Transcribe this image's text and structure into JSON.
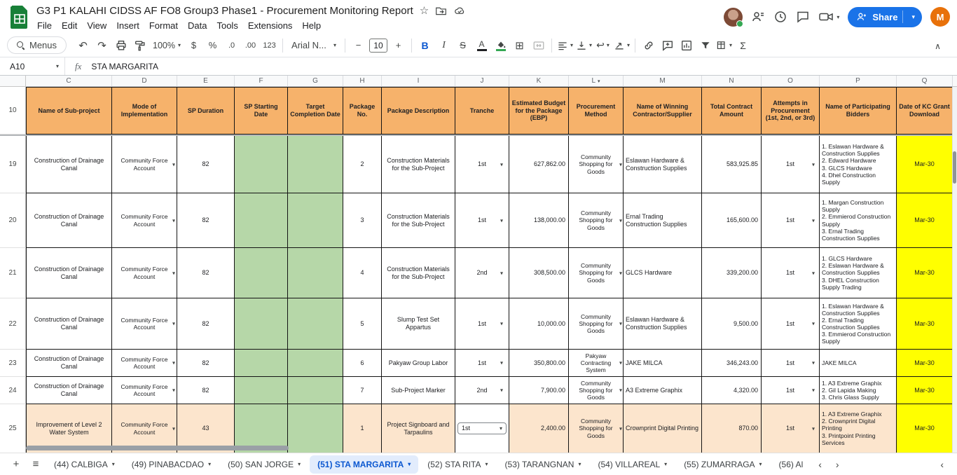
{
  "colors": {
    "accent_blue": "#1a73e8",
    "header_bg": "#f6b26b",
    "date_bg": "#b6d7a8",
    "kc_bg": "#ffff00",
    "active_row_bg": "#fce5cd",
    "active_tab_bg": "#e2ecfc",
    "active_tab_text": "#0b57d0",
    "avatar_bg": "#e8710a",
    "logo_green": "#188038"
  },
  "topbar": {
    "title": "G3 P1 KALAHI CIDSS AF  FO8 Group3 Phase1 - Procurement Monitoring Report",
    "share_label": "Share",
    "avatar_letter": "M"
  },
  "menu_items": [
    "File",
    "Edit",
    "View",
    "Insert",
    "Format",
    "Data",
    "Tools",
    "Extensions",
    "Help"
  ],
  "toolbar": {
    "menus_label": "Menus",
    "zoom": "100%",
    "font": "Arial N...",
    "font_size": "10"
  },
  "icons": {
    "undo": "↶",
    "redo": "↷",
    "star": "☆",
    "caret": "▾",
    "dollar": "$",
    "percent": "%",
    "dec_dec": ".0",
    "dec_inc": ".00",
    "num_fmt": "123",
    "minus": "−",
    "plus": "+",
    "bold": "B",
    "italic": "I",
    "strike": "S",
    "text_color": "A",
    "borders": "⊞",
    "wrap": "↩",
    "sigma": "Σ",
    "collapse": "∧",
    "all_sheets": "≡",
    "add_sheet": "+",
    "tab_prev": "‹",
    "tab_next": "›",
    "panel_collapse": "‹"
  },
  "formula_bar": {
    "cell_ref": "A10",
    "fx_label": "fx",
    "value": "STA MARGARITA"
  },
  "grid": {
    "columns": [
      "C",
      "D",
      "E",
      "F",
      "G",
      "H",
      "I",
      "J",
      "K",
      "L",
      "M",
      "N",
      "O",
      "P",
      "Q"
    ],
    "header_row_num": "10",
    "headers": [
      "Name of Sub-project",
      "Mode of Implementation",
      "SP Duration",
      "SP Starting Date",
      "Target Completion Date",
      "Package No.",
      "Package Description",
      "Tranche",
      "Estimated Budget for the Package (EBP)",
      "Procurement Method",
      "Name of Winning Contractor/Supplier",
      "Total Contract Amount",
      "Attempts in Procurement (1st, 2nd, or 3rd)",
      "Name of Participating Bidders",
      "Date of KC Grant Download"
    ],
    "rows": [
      {
        "num": "19",
        "name": "Construction of Drainage Canal",
        "mode": "Community Force Account",
        "duration": "82",
        "start": "",
        "target": "",
        "pkg": "2",
        "desc": "Construction Materials for the Sub-Project",
        "tranche": "1st",
        "ebp": "627,862.00",
        "method": "Community Shopping for Goods",
        "winner": "Eslawan Hardware & Construction Supplies",
        "amount": "583,925.85",
        "attempt": "1st",
        "bidders": "1. Eslawan Hardware & Construction Supplies\n2. Edward Hardware\n3. GLCS Hardware\n4. Dhel Construction Supply",
        "kc": "Mar-30"
      },
      {
        "num": "20",
        "name": "Construction of Drainage Canal",
        "mode": "Community Force Account",
        "duration": "82",
        "start": "",
        "target": "",
        "pkg": "3",
        "desc": "Construction Materials for the Sub-Project",
        "tranche": "1st",
        "ebp": "138,000.00",
        "method": "Community Shopping for Goods",
        "winner": "Ernal Trading Construction Supplies",
        "amount": "165,600.00",
        "attempt": "1st",
        "bidders": "1. Margan Construction Supply\n2. Emmierod Construction Supply\n3. Ernal Trading Construction Supplies",
        "kc": "Mar-30"
      },
      {
        "num": "21",
        "name": "Construction of Drainage Canal",
        "mode": "Community Force Account",
        "duration": "82",
        "start": "",
        "target": "",
        "pkg": "4",
        "desc": "Construction Materials for the Sub-Project",
        "tranche": "2nd",
        "ebp": "308,500.00",
        "method": "Community Shopping for Goods",
        "winner": "GLCS Hardware",
        "amount": "339,200.00",
        "attempt": "1st",
        "bidders": "1. GLCS Hardware\n2. Eslawan Hardware & Construction Supplies\n3. DHEL Construction Supply Trading",
        "kc": "Mar-30"
      },
      {
        "num": "22",
        "name": "Construction of Drainage Canal",
        "mode": "Community Force Account",
        "duration": "82",
        "start": "",
        "target": "",
        "pkg": "5",
        "desc": "Slump Test Set Appartus",
        "tranche": "1st",
        "ebp": "10,000.00",
        "method": "Community Shopping for Goods",
        "winner": "Eslawan Hardware & Construction Supplies",
        "amount": "9,500.00",
        "attempt": "1st",
        "bidders": "1. Eslawan Hardware & Construction Supplies\n2. Ernal Trading Construction Supplies\n3. Emmierod Construction Supply",
        "kc": "Mar-30"
      },
      {
        "num": "23",
        "name": "Construction of Drainage Canal",
        "mode": "Community Force Account",
        "duration": "82",
        "start": "",
        "target": "",
        "pkg": "6",
        "desc": "Pakyaw Group Labor",
        "tranche": "1st",
        "ebp": "350,800.00",
        "method": "Pakyaw Contracting System",
        "winner": "JAKE MILCA",
        "amount": "346,243.00",
        "attempt": "1st",
        "bidders": "JAKE MILCA",
        "kc": "Mar-30"
      },
      {
        "num": "24",
        "name": "Construction of Drainage Canal",
        "mode": "Community Force Account",
        "duration": "82",
        "start": "",
        "target": "",
        "pkg": "7",
        "desc": "Sub-Project Marker",
        "tranche": "2nd",
        "ebp": "7,900.00",
        "method": "Community Shopping for Goods",
        "winner": "A3 Extreme Graphix",
        "amount": "4,320.00",
        "attempt": "1st",
        "bidders": "1. A3 Extreme Graphix\n2. Gil Lapida Making\n3. Chris Glass Supply",
        "kc": "Mar-30"
      },
      {
        "num": "25",
        "highlight": true,
        "name": "Improvement of Level 2 Water System",
        "mode": "Community Force Account",
        "duration": "43",
        "start": "",
        "target": "",
        "pkg": "1",
        "desc": "Project Signboard and Tarpaulins",
        "tranche": "1st",
        "ebp": "2,400.00",
        "method": "Community Shopping for Goods",
        "winner": "Crownprint Digital Printing",
        "amount": "870.00",
        "attempt": "1st",
        "bidders": "1. A3 Extreme Graphix\n2. Crownprint Digital Printing\n3. Printpoint Printing Services",
        "kc": "Mar-30"
      }
    ]
  },
  "sheet_tabs": [
    {
      "label": "(44) CALBIGA"
    },
    {
      "label": "(49) PINABACDAO"
    },
    {
      "label": "(50) SAN JORGE"
    },
    {
      "label": "(51) STA MARGARITA",
      "active": true
    },
    {
      "label": "(52) STA RITA"
    },
    {
      "label": "(53) TARANGNAN"
    },
    {
      "label": "(54) VILLAREAL"
    },
    {
      "label": "(55) ZUMARRAGA"
    },
    {
      "label": "(56) Al",
      "truncated": true
    }
  ]
}
